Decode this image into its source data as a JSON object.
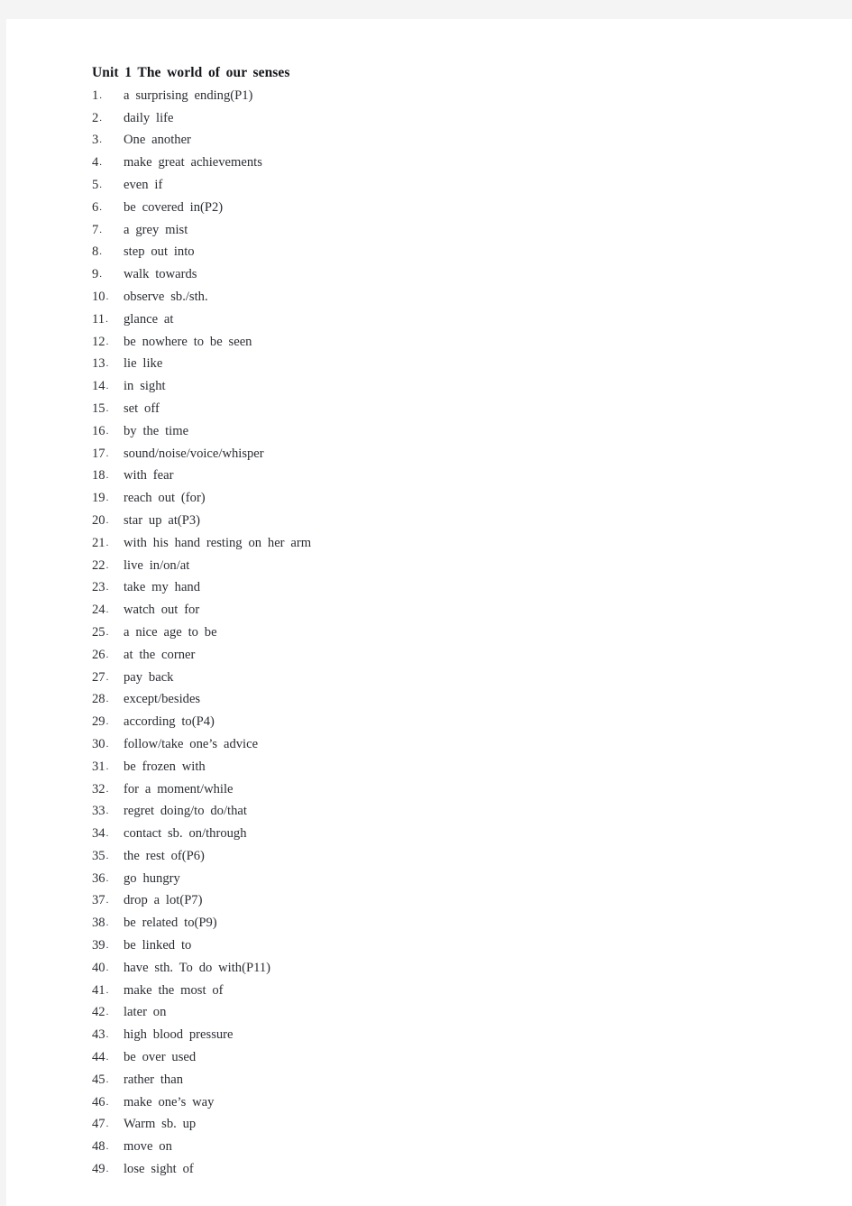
{
  "page": {
    "background_color": "#f4f4f4",
    "paper_color": "#ffffff",
    "text_color": "#2b2d33",
    "title_color": "#16171b"
  },
  "document": {
    "title": "Unit 1 The world of our senses",
    "items": [
      {
        "number": "1",
        "text": "a surprising ending(P1)"
      },
      {
        "number": "2",
        "text": "daily life"
      },
      {
        "number": "3",
        "text": "One another"
      },
      {
        "number": "4",
        "text": "make great achievements"
      },
      {
        "number": "5",
        "text": "even if"
      },
      {
        "number": "6",
        "text": "be covered in(P2)"
      },
      {
        "number": "7",
        "text": "a grey mist"
      },
      {
        "number": "8",
        "text": "step out into"
      },
      {
        "number": "9",
        "text": "walk towards"
      },
      {
        "number": "10",
        "text": "observe sb./sth."
      },
      {
        "number": "11",
        "text": "glance at"
      },
      {
        "number": "12",
        "text": "be nowhere to be seen"
      },
      {
        "number": "13",
        "text": "lie like"
      },
      {
        "number": "14",
        "text": "in sight"
      },
      {
        "number": "15",
        "text": "set off"
      },
      {
        "number": "16",
        "text": "by the time"
      },
      {
        "number": "17",
        "text": "sound/noise/voice/whisper"
      },
      {
        "number": "18",
        "text": "with fear"
      },
      {
        "number": "19",
        "text": "reach out (for)"
      },
      {
        "number": "20",
        "text": "star up at(P3)"
      },
      {
        "number": "21",
        "text": "with his hand resting on her arm"
      },
      {
        "number": "22",
        "text": "live in/on/at"
      },
      {
        "number": "23",
        "text": "take my hand"
      },
      {
        "number": "24",
        "text": "watch out for"
      },
      {
        "number": "25",
        "text": "a nice age to be"
      },
      {
        "number": "26",
        "text": "at the corner"
      },
      {
        "number": "27",
        "text": "pay back"
      },
      {
        "number": "28",
        "text": "except/besides"
      },
      {
        "number": "29",
        "text": "according to(P4)"
      },
      {
        "number": "30",
        "text": "follow/take one’s advice"
      },
      {
        "number": "31",
        "text": "be frozen with"
      },
      {
        "number": "32",
        "text": "for a moment/while"
      },
      {
        "number": "33",
        "text": "regret doing/to do/that"
      },
      {
        "number": "34",
        "text": "contact sb. on/through"
      },
      {
        "number": "35",
        "text": "the rest of(P6)"
      },
      {
        "number": "36",
        "text": "go hungry"
      },
      {
        "number": "37",
        "text": "drop a lot(P7)"
      },
      {
        "number": "38",
        "text": "be related to(P9)"
      },
      {
        "number": "39",
        "text": "be linked to"
      },
      {
        "number": "40",
        "text": "have sth. To do with(P11)"
      },
      {
        "number": "41",
        "text": "make the most of"
      },
      {
        "number": "42",
        "text": "later on"
      },
      {
        "number": "43",
        "text": "high blood pressure"
      },
      {
        "number": "44",
        "text": "be over used"
      },
      {
        "number": "45",
        "text": "rather than"
      },
      {
        "number": "46",
        "text": "make one’s way"
      },
      {
        "number": "47",
        "text": "Warm sb. up"
      },
      {
        "number": "48",
        "text": "move on"
      },
      {
        "number": "49",
        "text": "lose sight of"
      }
    ],
    "number_separator": "."
  }
}
